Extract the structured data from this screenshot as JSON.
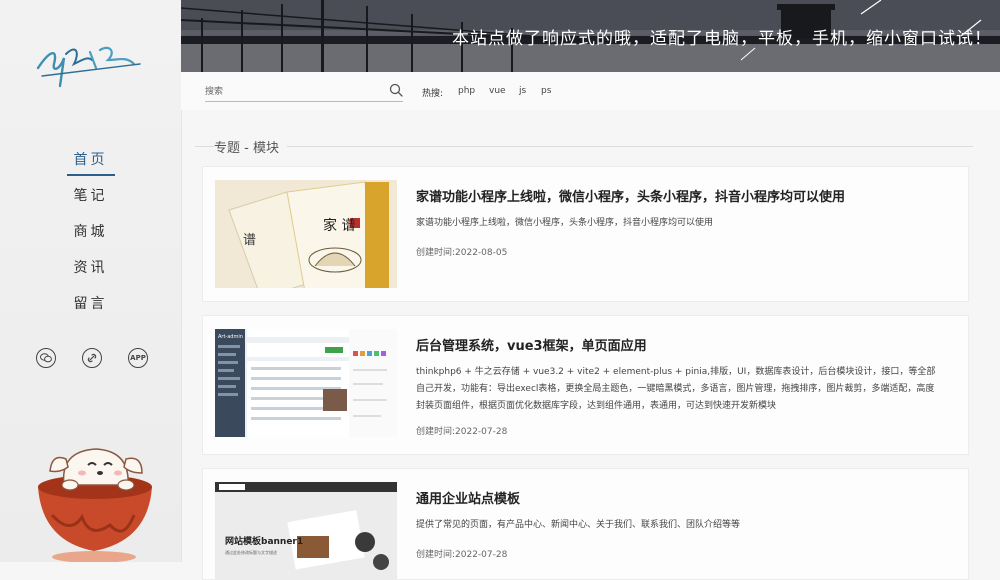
{
  "sidebar": {
    "nav": [
      {
        "label": "首页",
        "active": true
      },
      {
        "label": "笔记",
        "active": false
      },
      {
        "label": "商城",
        "active": false
      },
      {
        "label": "资讯",
        "active": false
      },
      {
        "label": "留言",
        "active": false
      }
    ],
    "socials": [
      {
        "icon": "wechat-icon",
        "glyph": "◎"
      },
      {
        "icon": "link-icon",
        "glyph": "∞"
      },
      {
        "icon": "app-icon",
        "glyph": "APP"
      }
    ]
  },
  "banner": {
    "text": "本站点做了响应式的哦，适配了电脑，平板，手机，缩小窗口试试！"
  },
  "search": {
    "placeholder": "搜索",
    "hot_label": "热搜:",
    "hot_tags": [
      "php",
      "vue",
      "js",
      "ps"
    ]
  },
  "section": {
    "title": "专题 - 模块"
  },
  "cards": [
    {
      "title": "家谱功能小程序上线啦，微信小程序，头条小程序，抖音小程序均可以使用",
      "desc": "家谱功能小程序上线啦，微信小程序，头条小程序，抖音小程序均可以使用",
      "date": "创建时间:2022-08-05",
      "thumb": {
        "book_title": "家 谱",
        "book2": "谱"
      }
    },
    {
      "title": "后台管理系统，vue3框架，单页面应用",
      "desc": "thinkphp6 + 牛之云存储 + vue3.2 + vite2 + element-plus + pinia,排版，UI，数据库表设计，后台模块设计，接口，等全部自己开发，功能有：导出execl表格，更换全局主题色，一键暗黑模式，多语言，图片管理，拖拽排序，图片裁剪，多端适配，高度封装页面组件，根据页面优化数据库字段，达到组件通用，表通用，可达到快速开发新模块",
      "date": "创建时间:2022-07-28",
      "thumb": {
        "app_name": "Art-admin"
      }
    },
    {
      "title": "通用企业站点模板",
      "desc": "提供了常见的页面，有产品中心、新闻中心、关于我们、联系我们、团队介绍等等",
      "date": "创建时间:2022-07-28",
      "thumb": {
        "banner_title": "网站模板banner1",
        "banner_sub": "通过此处修改标题与文字描述"
      }
    }
  ],
  "colors": {
    "accent": "#2b5f8c",
    "background": "#f6f6f6"
  }
}
